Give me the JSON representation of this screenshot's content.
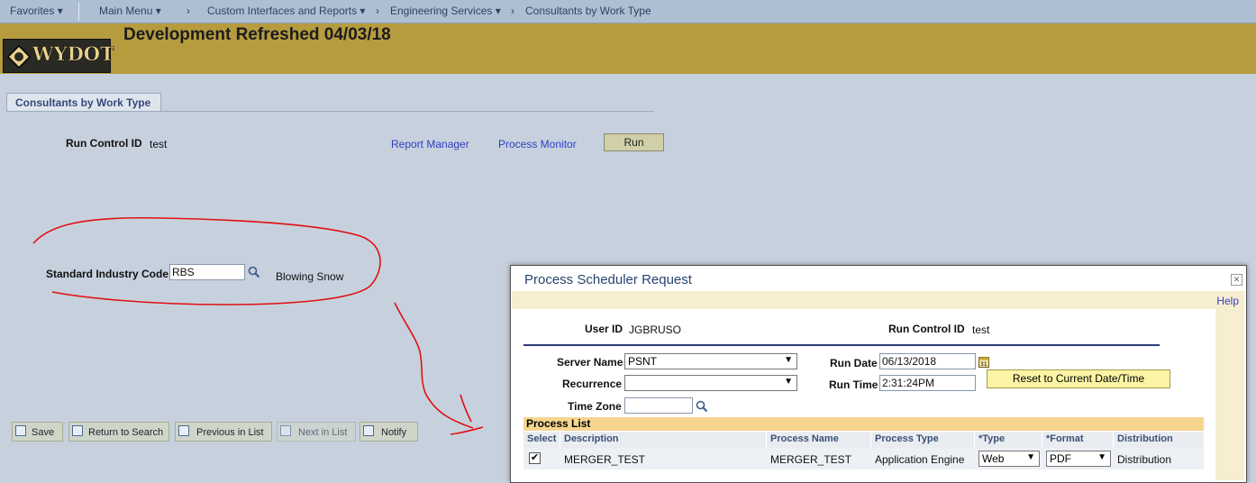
{
  "nav": {
    "favorites": "Favorites",
    "main_menu": "Main Menu",
    "crumb1": "Custom Interfaces and Reports",
    "crumb2": "Engineering Services",
    "crumb3": "Consultants by Work Type"
  },
  "banner": {
    "logo": "WYDOT",
    "title": "Development Refreshed 04/03/18"
  },
  "tab": {
    "label": "Consultants by Work Type"
  },
  "run_control": {
    "label": "Run Control ID",
    "value": "test",
    "report_manager": "Report Manager",
    "process_monitor": "Process Monitor",
    "run_button": "Run"
  },
  "sic": {
    "label": "Standard Industry Code",
    "value": "RBS",
    "description": "Blowing Snow"
  },
  "toolbar": {
    "save": "Save",
    "return_to_search": "Return to Search",
    "previous_in_list": "Previous in List",
    "next_in_list": "Next in List",
    "notify": "Notify"
  },
  "modal": {
    "title": "Process Scheduler Request",
    "help": "Help",
    "user_id_label": "User ID",
    "user_id": "JGBRUSO",
    "run_control_label": "Run Control ID",
    "run_control": "test",
    "server_name_label": "Server Name",
    "server_name": "PSNT",
    "recurrence_label": "Recurrence",
    "recurrence": "",
    "time_zone_label": "Time Zone",
    "time_zone": "",
    "run_date_label": "Run Date",
    "run_date": "06/13/2018",
    "run_time_label": "Run Time",
    "run_time": "2:31:24PM",
    "reset_button": "Reset to Current Date/Time",
    "process_list": {
      "title": "Process List",
      "columns": [
        "Select",
        "Description",
        "Process Name",
        "Process Type",
        "*Type",
        "*Format",
        "Distribution"
      ],
      "rows": [
        {
          "selected": true,
          "description": "MERGER_TEST",
          "process_name": "MERGER_TEST",
          "process_type": "Application Engine",
          "type": "Web",
          "format": "PDF",
          "distribution": "Distribution"
        }
      ]
    }
  },
  "colors": {
    "annotation": "#e01010",
    "banner": "#b79c3f",
    "background": "#c7d1de"
  }
}
